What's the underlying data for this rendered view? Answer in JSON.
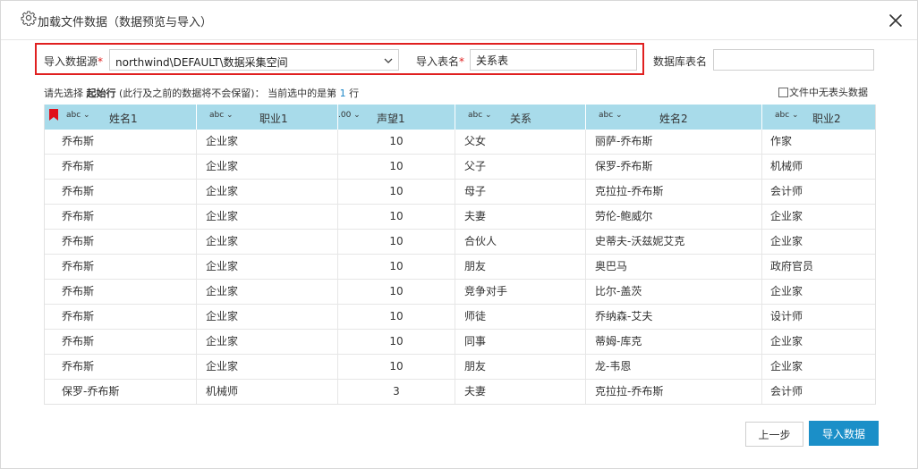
{
  "dialog": {
    "title": "加载文件数据（数据预览与导入）"
  },
  "config": {
    "datasource_label": "导入数据源",
    "datasource_value": "northwind\\DEFAULT\\数据采集空间",
    "tablename_label": "导入表名",
    "tablename_value": "关系表",
    "dbtable_label": "数据库表名",
    "dbtable_value": "",
    "required_mark": "*"
  },
  "hint": {
    "prefix": "请先选择 ",
    "bold": "起始行",
    "middle": " (此行及之前的数据将不会保留)：  当前选中的是第 ",
    "row_number": "1",
    "suffix": " 行"
  },
  "no_header_label": "文件中无表头数据",
  "columns": [
    {
      "type": "abc ⌄",
      "name": "姓名1"
    },
    {
      "type": "abc ⌄",
      "name": "职业1"
    },
    {
      "type": ".00 ⌄",
      "name": "声望1"
    },
    {
      "type": "abc ⌄",
      "name": "关系"
    },
    {
      "type": "abc ⌄",
      "name": "姓名2"
    },
    {
      "type": "abc ⌄",
      "name": "职业2"
    }
  ],
  "rows": [
    [
      "乔布斯",
      "企业家",
      "10",
      "父女",
      "丽萨-乔布斯",
      "作家"
    ],
    [
      "乔布斯",
      "企业家",
      "10",
      "父子",
      "保罗-乔布斯",
      "机械师"
    ],
    [
      "乔布斯",
      "企业家",
      "10",
      "母子",
      "克拉拉-乔布斯",
      "会计师"
    ],
    [
      "乔布斯",
      "企业家",
      "10",
      "夫妻",
      "劳伦-鲍威尔",
      "企业家"
    ],
    [
      "乔布斯",
      "企业家",
      "10",
      "合伙人",
      "史蒂夫-沃兹妮艾克",
      "企业家"
    ],
    [
      "乔布斯",
      "企业家",
      "10",
      "朋友",
      "奥巴马",
      "政府官员"
    ],
    [
      "乔布斯",
      "企业家",
      "10",
      "竞争对手",
      "比尔-盖茨",
      "企业家"
    ],
    [
      "乔布斯",
      "企业家",
      "10",
      "师徒",
      "乔纳森-艾夫",
      "设计师"
    ],
    [
      "乔布斯",
      "企业家",
      "10",
      "同事",
      "蒂姆-库克",
      "企业家"
    ],
    [
      "乔布斯",
      "企业家",
      "10",
      "朋友",
      "龙-韦恩",
      "企业家"
    ],
    [
      "保罗-乔布斯",
      "机械师",
      "3",
      "夫妻",
      "克拉拉-乔布斯",
      "会计师"
    ]
  ],
  "buttons": {
    "prev": "上一步",
    "import": "导入数据"
  },
  "colors": {
    "header_bg": "#a8dbea",
    "accent": "#1b8fc8",
    "highlight_border": "#e02020",
    "flag": "#e0101a"
  },
  "icons": {
    "title": "gear-icon",
    "close": "close-icon",
    "dropdown": "chevron-down-icon",
    "start_row": "bookmark-flag-icon"
  }
}
